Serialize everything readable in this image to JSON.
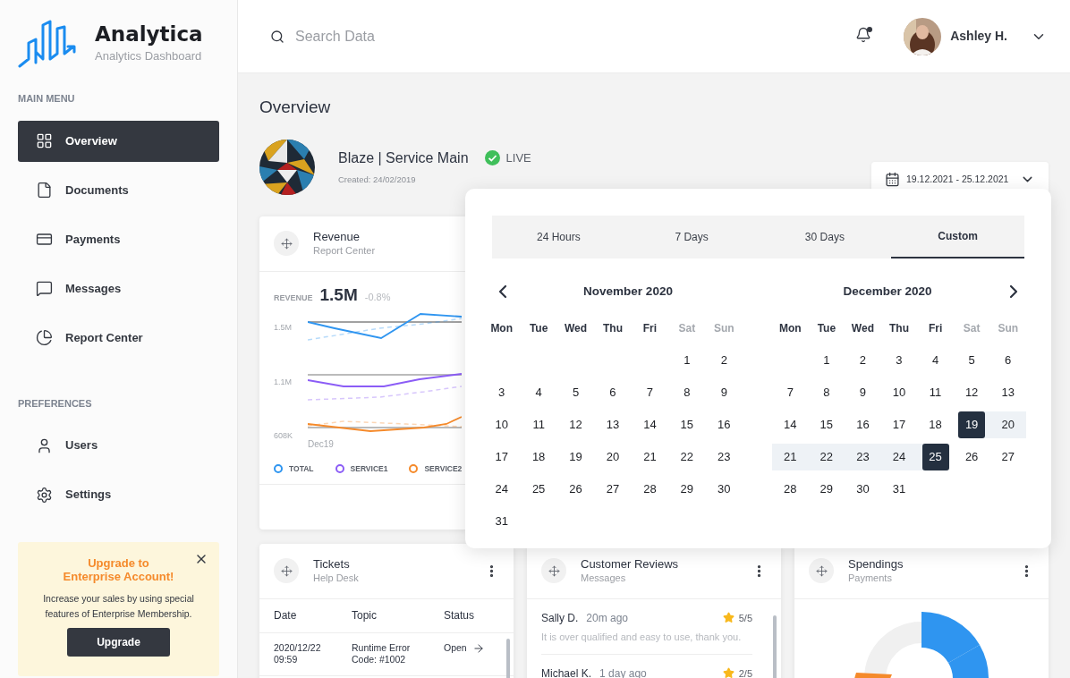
{
  "sidebar": {
    "brand": {
      "name": "Analytica",
      "tagline": "Analytics Dashboard"
    },
    "sections": [
      {
        "heading": "MAIN MENU",
        "items": [
          {
            "label": "Overview",
            "selected": true
          },
          {
            "label": "Documents",
            "selected": false
          },
          {
            "label": "Payments",
            "selected": false
          },
          {
            "label": "Messages",
            "selected": false
          },
          {
            "label": "Report Center",
            "selected": false
          }
        ]
      },
      {
        "heading": "PREFERENCES",
        "items": [
          {
            "label": "Users",
            "selected": false
          },
          {
            "label": "Settings",
            "selected": false
          }
        ]
      }
    ],
    "upgrade_card": {
      "title_lines": [
        "Upgrade to",
        "Enterprise Account!"
      ],
      "text": "Increase your sales by using special features of Enterprise Membership.",
      "button": "Upgrade"
    }
  },
  "header": {
    "search": {
      "placeholder": "Search Data"
    },
    "notifications": {
      "unread": true
    },
    "user": {
      "name": "Ashley H."
    }
  },
  "page": {
    "title": "Overview"
  },
  "project": {
    "name": "Blaze | Service Main",
    "status": "LIVE",
    "created": "Created: 24/02/2019",
    "date_range": "19.12.2021 - 25.12.2021"
  },
  "revenue_card": {
    "title": "Revenue",
    "subtitle": "Report Center",
    "metric_label": "REVENUE",
    "metric_value": "1.5M",
    "metric_change": "-0.8%",
    "y_labels": [
      "1.5M",
      "1.1M",
      "608K"
    ],
    "x_label": "Dec19",
    "legend": [
      {
        "label": "TOTAL",
        "color": "#2f95f0"
      },
      {
        "label": "SERVICE1",
        "color": "#8b5cf6"
      },
      {
        "label": "SERVICE2",
        "color": "#f58a2b"
      }
    ]
  },
  "tickets_card": {
    "title": "Tickets",
    "subtitle": "Help Desk",
    "columns": [
      "Date",
      "Topic",
      "Status"
    ],
    "rows": [
      {
        "date": "2020/12/22",
        "time": "09:59",
        "topic": "Runtime Error",
        "code": "Code: #1002",
        "status": "Open"
      }
    ]
  },
  "reviews_card": {
    "title": "Customer Reviews",
    "subtitle": "Messages",
    "reviews": [
      {
        "name": "Sally D.",
        "time": "20m ago",
        "rating": "5/5",
        "text": "It is over qualified and easy to use, thank you."
      },
      {
        "name": "Michael K.",
        "time": "1 day ago",
        "rating": "2/5"
      }
    ]
  },
  "spendings_card": {
    "title": "Spendings",
    "subtitle": "Payments"
  },
  "date_picker": {
    "tabs": [
      {
        "label": "24 Hours",
        "selected": false
      },
      {
        "label": "7 Days",
        "selected": false
      },
      {
        "label": "30 Days",
        "selected": false
      },
      {
        "label": "Custom",
        "selected": true
      }
    ],
    "months": [
      {
        "title": "November 2020",
        "weekdays": [
          {
            "label": "Mon",
            "weekend": false
          },
          {
            "label": "Tue",
            "weekend": false
          },
          {
            "label": "Wed",
            "weekend": false
          },
          {
            "label": "Thu",
            "weekend": false
          },
          {
            "label": "Fri",
            "weekend": false
          },
          {
            "label": "Sat",
            "weekend": true
          },
          {
            "label": "Sun",
            "weekend": true
          }
        ],
        "weeks": [
          {
            "days": [
              {
                "d": "1",
                "selected": false,
                "in_range": false
              },
              {
                "d": "2",
                "selected": false,
                "in_range": false
              }
            ]
          },
          {
            "days": [
              {
                "d": "3",
                "selected": false,
                "in_range": false
              },
              {
                "d": "4",
                "selected": false,
                "in_range": false
              },
              {
                "d": "5",
                "selected": false,
                "in_range": false
              },
              {
                "d": "6",
                "selected": false,
                "in_range": false
              },
              {
                "d": "7",
                "selected": false,
                "in_range": false
              },
              {
                "d": "8",
                "selected": false,
                "in_range": false
              },
              {
                "d": "9",
                "selected": false,
                "in_range": false
              }
            ]
          },
          {
            "days": [
              {
                "d": "10",
                "selected": false,
                "in_range": false
              },
              {
                "d": "11",
                "selected": false,
                "in_range": false
              },
              {
                "d": "12",
                "selected": false,
                "in_range": false
              },
              {
                "d": "13",
                "selected": false,
                "in_range": false
              },
              {
                "d": "14",
                "selected": false,
                "in_range": false
              },
              {
                "d": "15",
                "selected": false,
                "in_range": false
              },
              {
                "d": "16",
                "selected": false,
                "in_range": false
              }
            ]
          },
          {
            "days": [
              {
                "d": "17",
                "selected": false,
                "in_range": false
              },
              {
                "d": "18",
                "selected": false,
                "in_range": false
              },
              {
                "d": "19",
                "selected": false,
                "in_range": false
              },
              {
                "d": "20",
                "selected": false,
                "in_range": false
              },
              {
                "d": "21",
                "selected": false,
                "in_range": false
              },
              {
                "d": "22",
                "selected": false,
                "in_range": false
              },
              {
                "d": "23",
                "selected": false,
                "in_range": false
              }
            ]
          },
          {
            "days": [
              {
                "d": "24",
                "selected": false,
                "in_range": false
              },
              {
                "d": "25",
                "selected": false,
                "in_range": false
              },
              {
                "d": "26",
                "selected": false,
                "in_range": false
              },
              {
                "d": "27",
                "selected": false,
                "in_range": false
              },
              {
                "d": "28",
                "selected": false,
                "in_range": false
              },
              {
                "d": "29",
                "selected": false,
                "in_range": false
              },
              {
                "d": "30",
                "selected": false,
                "in_range": false
              }
            ]
          },
          {
            "days": [
              {
                "d": "31",
                "selected": false,
                "in_range": false
              }
            ]
          }
        ]
      },
      {
        "title": "December 2020",
        "weekdays": [
          {
            "label": "Mon",
            "weekend": false
          },
          {
            "label": "Tue",
            "weekend": false
          },
          {
            "label": "Wed",
            "weekend": false
          },
          {
            "label": "Thu",
            "weekend": false
          },
          {
            "label": "Fri",
            "weekend": false
          },
          {
            "label": "Sat",
            "weekend": true
          },
          {
            "label": "Sun",
            "weekend": true
          }
        ],
        "weeks": [
          {
            "days": [
              {
                "d": "1",
                "selected": false,
                "in_range": false
              },
              {
                "d": "2",
                "selected": false,
                "in_range": false
              },
              {
                "d": "3",
                "selected": false,
                "in_range": false
              },
              {
                "d": "4",
                "selected": false,
                "in_range": false
              },
              {
                "d": "5",
                "selected": false,
                "in_range": false
              },
              {
                "d": "6",
                "selected": false,
                "in_range": false
              }
            ]
          },
          {
            "days": [
              {
                "d": "7",
                "selected": false,
                "in_range": false
              },
              {
                "d": "8",
                "selected": false,
                "in_range": false
              },
              {
                "d": "9",
                "selected": false,
                "in_range": false
              },
              {
                "d": "10",
                "selected": false,
                "in_range": false
              },
              {
                "d": "11",
                "selected": false,
                "in_range": false
              },
              {
                "d": "12",
                "selected": false,
                "in_range": false
              },
              {
                "d": "13",
                "selected": false,
                "in_range": false
              }
            ]
          },
          {
            "days": [
              {
                "d": "14",
                "selected": false,
                "in_range": false
              },
              {
                "d": "15",
                "selected": false,
                "in_range": false
              },
              {
                "d": "16",
                "selected": false,
                "in_range": false
              },
              {
                "d": "17",
                "selected": false,
                "in_range": false
              },
              {
                "d": "18",
                "selected": false,
                "in_range": false
              },
              {
                "d": "19",
                "selected": true,
                "in_range": false
              },
              {
                "d": "20",
                "selected": false,
                "in_range": true
              }
            ]
          },
          {
            "days": [
              {
                "d": "21",
                "selected": false,
                "in_range": true
              },
              {
                "d": "22",
                "selected": false,
                "in_range": true
              },
              {
                "d": "23",
                "selected": false,
                "in_range": true
              },
              {
                "d": "24",
                "selected": false,
                "in_range": true
              },
              {
                "d": "25",
                "selected": true,
                "in_range": false
              },
              {
                "d": "26",
                "selected": false,
                "in_range": false
              },
              {
                "d": "27",
                "selected": false,
                "in_range": false
              }
            ]
          },
          {
            "days": [
              {
                "d": "28",
                "selected": false,
                "in_range": false
              },
              {
                "d": "29",
                "selected": false,
                "in_range": false
              },
              {
                "d": "30",
                "selected": false,
                "in_range": false
              },
              {
                "d": "31",
                "selected": false,
                "in_range": false
              }
            ]
          }
        ]
      }
    ]
  }
}
